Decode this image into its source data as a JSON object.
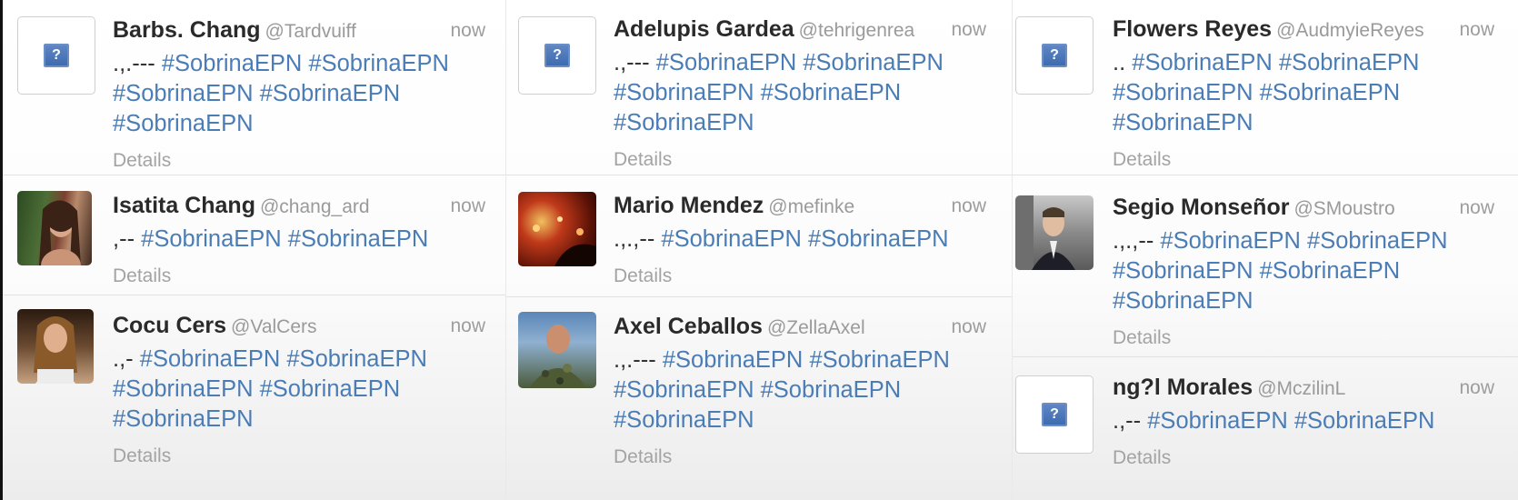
{
  "columns": [
    [
      {
        "name": "Barbs. Chang",
        "handle": "@Tardvuiff",
        "time": "now",
        "prefix": ".,.---",
        "tags": [
          "#SobrinaEPN",
          "#SobrinaEPN",
          "#SobrinaEPN",
          "#SobrinaEPN",
          "#SobrinaEPN"
        ],
        "avatar": "placeholder",
        "details": "Details"
      },
      {
        "name": "Isatita Chang",
        "handle": "@chang_ard",
        "time": "now",
        "prefix": ",--",
        "tags": [
          "#SobrinaEPN",
          "#SobrinaEPN"
        ],
        "avatar": "photo-woman-dark-hair",
        "details": "Details"
      },
      {
        "name": "Cocu Cers",
        "handle": "@ValCers",
        "time": "now",
        "prefix": ".,-",
        "tags": [
          "#SobrinaEPN",
          "#SobrinaEPN",
          "#SobrinaEPN",
          "#SobrinaEPN",
          "#SobrinaEPN"
        ],
        "avatar": "photo-woman-blonde",
        "details": "Details"
      }
    ],
    [
      {
        "name": "Adelupis Gardea",
        "handle": "@tehrigenrea",
        "time": "now",
        "prefix": ".,---",
        "tags": [
          "#SobrinaEPN",
          "#SobrinaEPN",
          "#SobrinaEPN",
          "#SobrinaEPN",
          "#SobrinaEPN"
        ],
        "avatar": "placeholder",
        "details": "Details"
      },
      {
        "name": "Mario Mendez",
        "handle": "@mefinke",
        "time": "now",
        "prefix": ".,.,--",
        "tags": [
          "#SobrinaEPN",
          "#SobrinaEPN"
        ],
        "avatar": "photo-dark-red",
        "details": "Details"
      },
      {
        "name": "Axel Ceballos",
        "handle": "@ZellaAxel",
        "time": "now",
        "prefix": ".,.---",
        "tags": [
          "#SobrinaEPN",
          "#SobrinaEPN",
          "#SobrinaEPN",
          "#SobrinaEPN",
          "#SobrinaEPN"
        ],
        "avatar": "photo-man-camo",
        "details": "Details"
      }
    ],
    [
      {
        "name": "Flowers Reyes",
        "handle": "@AudmyieReyes",
        "time": "now",
        "prefix": "..",
        "tags": [
          "#SobrinaEPN",
          "#SobrinaEPN",
          "#SobrinaEPN",
          "#SobrinaEPN",
          "#SobrinaEPN"
        ],
        "avatar": "placeholder",
        "details": "Details"
      },
      {
        "name": "Segio Monseñor",
        "handle": "@SMoustro",
        "time": "now",
        "prefix": ".,.,--",
        "tags": [
          "#SobrinaEPN",
          "#SobrinaEPN",
          "#SobrinaEPN",
          "#SobrinaEPN",
          "#SobrinaEPN"
        ],
        "avatar": "photo-man-suit",
        "details": "Details"
      },
      {
        "name": "ng?l Morales",
        "handle": "@MczilinL",
        "time": "now",
        "prefix": ".,--",
        "tags": [
          "#SobrinaEPN",
          "#SobrinaEPN"
        ],
        "avatar": "placeholder",
        "details": "Details"
      }
    ]
  ],
  "colors": {
    "hashtag": "#4a7cb6",
    "name": "#2a2a2a",
    "muted": "#9a9a9a"
  }
}
